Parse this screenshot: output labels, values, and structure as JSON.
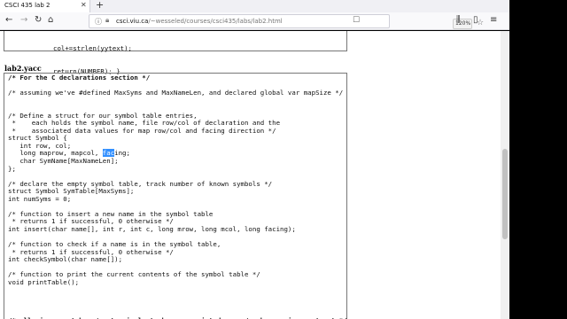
{
  "browser": {
    "tab_title": "CSCI 435 lab 2",
    "tab_close": "✕",
    "new_tab": "+",
    "url_host": "csci.viu.ca",
    "url_path": "/~wesseled/courses/csci435/labs/lab2.html",
    "zoom": "120%",
    "icons": [
      "back-icon",
      "forward-icon",
      "reload-icon",
      "home-icon",
      "info-icon",
      "lock-icon",
      "page-actions-icon",
      "bookmark-star-icon",
      "library-icon",
      "sidebar-icon",
      "menu-icon"
    ]
  },
  "page": {
    "top_code_lines": [
      "col+=strlen(yytext);",
      "return(NUMBER); }"
    ],
    "section_title": "lab2.yacc",
    "code_lines": [
      "/* For the C declarations section */",
      "",
      "/* assuming we've #defined MaxSyms and MaxNameLen, and declared global var mapSize */",
      "",
      "",
      "/* Define a struct for our symbol table entries,",
      " *    each holds the symbol name, file row/col of declaration and the",
      " *    associated data values for map row/col and facing direction */",
      "struct Symbol {",
      "   int row, col;",
      "   long maprow, mapcol, facing;",
      "   char SymName[MaxNameLen];",
      "};",
      "",
      "/* declare the empty symbol table, track number of known symbols */",
      "struct Symbol SymTable[MaxSyms];",
      "int numSyms = 0;",
      "",
      "/* function to insert a new name in the symbol table",
      " * returns 1 if successful, 0 otherwise */",
      "int insert(char name[], int r, int c, long mrow, long mcol, long facing);",
      "",
      "/* function to check if a name is in the symbol table,",
      " * returns 1 if successful, 0 otherwise */",
      "int checkSymbol(char name[]);",
      "",
      "/* function to print the current contents of the symbol table */",
      "void printTable();",
      "",
      "",
      "",
      "",
      "/* allowing our tokens/nonterminals to have associated names/numbers using a struct */"
    ],
    "selected_text": "fac"
  }
}
